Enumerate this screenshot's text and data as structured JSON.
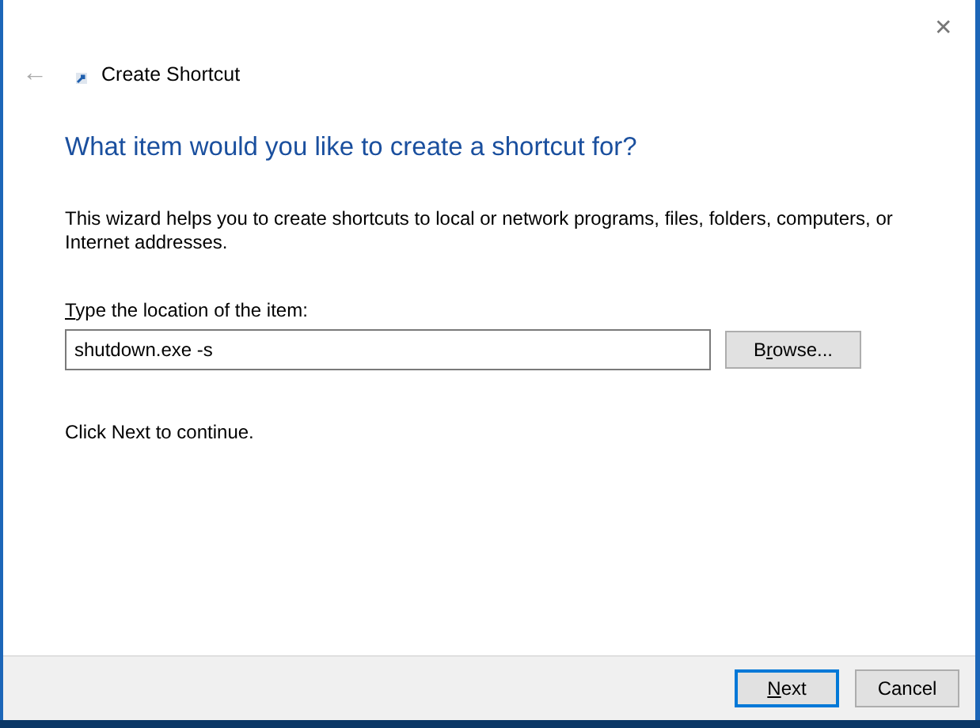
{
  "window": {
    "close_glyph": "✕"
  },
  "header": {
    "back_glyph": "←",
    "title": "Create Shortcut"
  },
  "heading": "What item would you like to create a shortcut for?",
  "description": "This wizard helps you to create shortcuts to local or network programs, files, folders, computers, or Internet addresses.",
  "location": {
    "label": {
      "key": "T",
      "after": "ype the location of the item:"
    },
    "value": "shutdown.exe -s"
  },
  "browse_button": {
    "before": "B",
    "key": "r",
    "after": "owse..."
  },
  "hint": "Click Next to continue.",
  "buttons": [
    {
      "key": "N",
      "after": "ext",
      "default": true
    },
    {
      "before": "Cancel",
      "default": false
    }
  ]
}
